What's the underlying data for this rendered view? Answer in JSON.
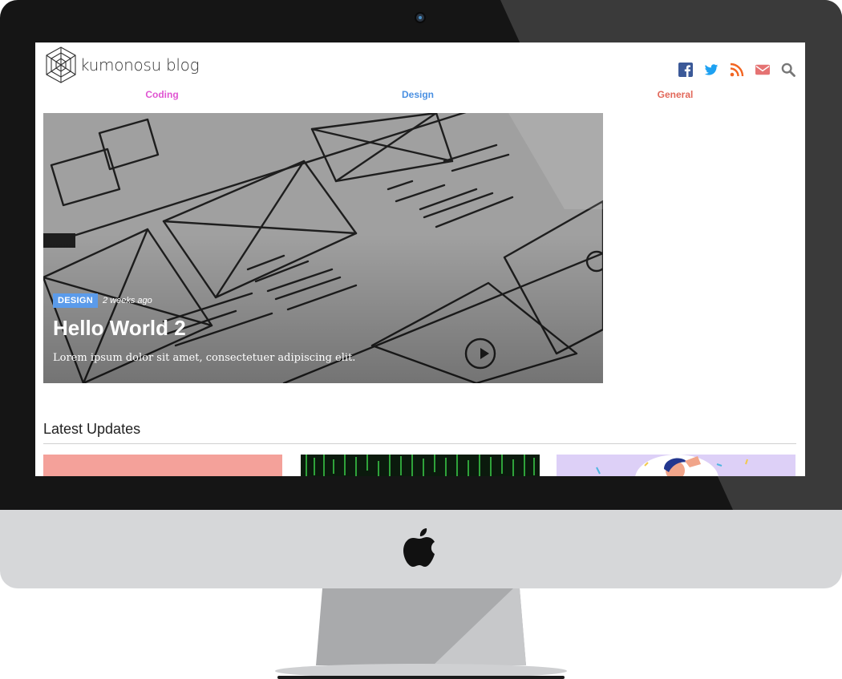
{
  "blog": {
    "name": "kumonosu blog"
  },
  "social": [
    {
      "icon": "facebook-icon",
      "color": "#3b5998"
    },
    {
      "icon": "twitter-icon",
      "color": "#1da1f2"
    },
    {
      "icon": "rss-icon",
      "color": "#f26522"
    },
    {
      "icon": "mail-icon",
      "color": "#e57373"
    },
    {
      "icon": "search-icon",
      "color": "#777777"
    }
  ],
  "nav": [
    {
      "label": "Coding",
      "color": "#e056d2"
    },
    {
      "label": "Design",
      "color": "#4a90e2"
    },
    {
      "label": "General",
      "color": "#e2685a"
    }
  ],
  "hero": {
    "category": "DESIGN",
    "time_ago": "2 weeks ago",
    "title": "Hello World 2",
    "excerpt": "Lorem ipsum dolor sit amet, consectetuer adipiscing elit.",
    "category_color": "#5b9bea"
  },
  "latest": {
    "title": "Latest Updates",
    "cards": [
      {
        "thumb": "salmon-pink-image",
        "color": "#f4a19a"
      },
      {
        "thumb": "matrix-code-image",
        "color": "#0b1a0d"
      },
      {
        "thumb": "illustration-person-image",
        "color": "#ddd0f7"
      }
    ]
  }
}
